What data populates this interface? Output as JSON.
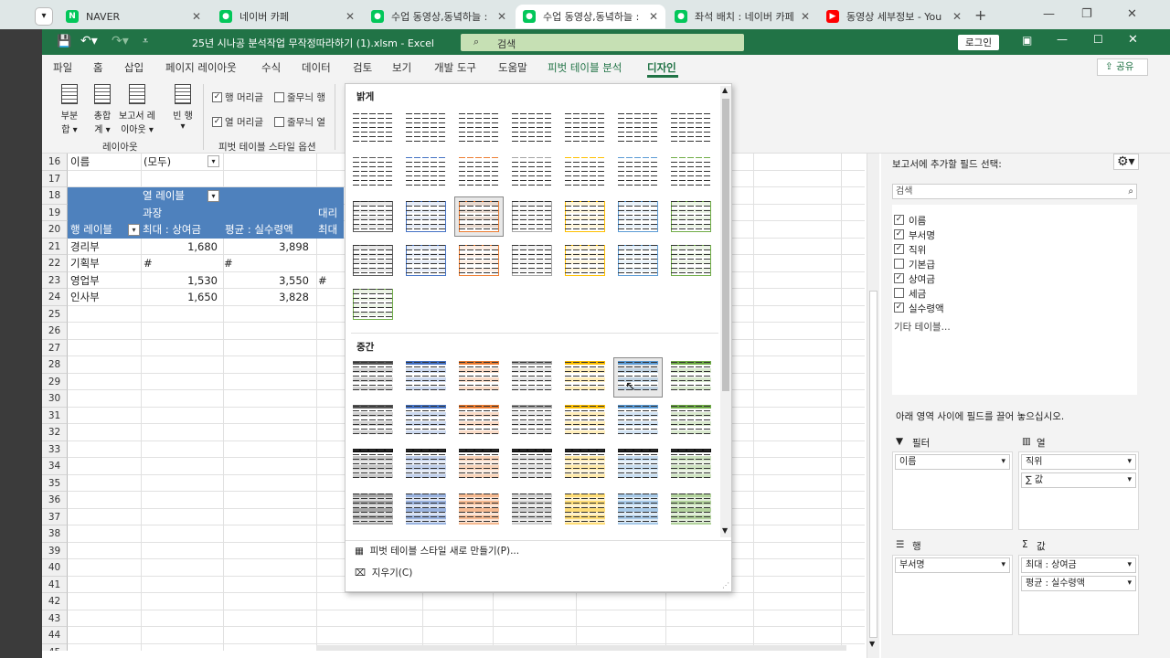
{
  "browser": {
    "tabs": [
      {
        "label": "NAVER",
        "active": false,
        "icon": "naver-icon",
        "color": "#03c75a"
      },
      {
        "label": "네이버 카페",
        "active": false,
        "icon": "cafe-icon",
        "color": "#03c75a"
      },
      {
        "label": "수업 동영상,동녘하늘 :",
        "active": false,
        "icon": "cafe-icon",
        "color": "#03c75a"
      },
      {
        "label": "수업 동영상,동녘하늘 :",
        "active": true,
        "icon": "cafe-icon",
        "color": "#03c75a"
      },
      {
        "label": "좌석 배치 : 네이버 카페",
        "active": false,
        "icon": "cafe-icon",
        "color": "#03c75a"
      },
      {
        "label": "동영상 세부정보 - You",
        "active": false,
        "icon": "youtube-icon",
        "color": "#ff0000"
      }
    ],
    "new_tab": "+"
  },
  "excel": {
    "filename": "25년 시나공 분석작업 무작정따라하기 (1).xlsm",
    "app": "Excel",
    "search_placeholder": "검색",
    "login": "로그인",
    "share": "공유",
    "menu": [
      "파일",
      "홈",
      "삽입",
      "페이지 레이아웃",
      "수식",
      "데이터",
      "검토",
      "보기",
      "개발 도구",
      "도움말",
      "피벗 테이블 분석",
      "디자인"
    ],
    "active_menu": "디자인",
    "ribbon": {
      "layout_buttons": [
        {
          "line1": "부분",
          "line2": "합 ▾"
        },
        {
          "line1": "총합",
          "line2": "계 ▾"
        },
        {
          "line1": "보고서 레",
          "line2": "이아웃 ▾"
        },
        {
          "line1": "빈 행",
          "line2": "▾"
        }
      ],
      "layout_group": "레이아웃",
      "options": [
        {
          "label": "행 머리글",
          "checked": true
        },
        {
          "label": "줄무늬 행",
          "checked": false
        },
        {
          "label": "열 머리글",
          "checked": true
        },
        {
          "label": "줄무늬 열",
          "checked": false
        }
      ],
      "options_group": "피벗 테이블 스타일 옵션"
    }
  },
  "sheet": {
    "rows": [
      "16",
      "17",
      "18",
      "19",
      "20",
      "21",
      "22",
      "23",
      "24",
      "25",
      "26",
      "27",
      "28",
      "29",
      "30",
      "31",
      "32",
      "33",
      "34",
      "35",
      "36",
      "37",
      "38",
      "39",
      "40",
      "41",
      "42",
      "43",
      "44",
      "45"
    ],
    "filter_label": "이름",
    "filter_value": "(모두)",
    "pivot": {
      "col_label": "열 레이블",
      "group1": "과장",
      "group2": "대리",
      "row_label": "행 레이블",
      "h1": "최대 : 상여금",
      "h2": "평균 : 실수령액",
      "h3": "최대",
      "data": [
        {
          "name": "경리부",
          "v1": "1,680",
          "v2": "3,898",
          "v3": ""
        },
        {
          "name": "기획부",
          "v1": "#",
          "v2": "#",
          "v3": ""
        },
        {
          "name": "영업부",
          "v1": "1,530",
          "v2": "3,550",
          "v3": "#"
        },
        {
          "name": "인사부",
          "v1": "1,650",
          "v2": "3,828",
          "v3": ""
        }
      ]
    }
  },
  "gallery": {
    "section_light": "밝게",
    "section_medium": "중간",
    "new_style": "피벗 테이블 스타일 새로 만들기(P)...",
    "clear": "지우기(C)",
    "colors": [
      "#595959",
      "#4472c4",
      "#ed7d31",
      "#a5a5a5",
      "#ffc000",
      "#5b9bd5",
      "#70ad47"
    ]
  },
  "pane": {
    "choose_fields": "보고서에 추가할 필드 선택:",
    "search_placeholder": "검색",
    "fields": [
      {
        "label": "이름",
        "checked": true
      },
      {
        "label": "부서명",
        "checked": true
      },
      {
        "label": "직위",
        "checked": true
      },
      {
        "label": "기본급",
        "checked": false
      },
      {
        "label": "상여금",
        "checked": true
      },
      {
        "label": "세금",
        "checked": false
      },
      {
        "label": "실수령액",
        "checked": true
      }
    ],
    "more_tables": "기타 테이블...",
    "drag_hint": "아래 영역 사이에 필드를 끌어 놓으십시오.",
    "filters": "필터",
    "columns": "열",
    "rows": "행",
    "values": "값",
    "filter_items": [
      "이름"
    ],
    "column_items": [
      "직위",
      "∑ 값"
    ],
    "row_items": [
      "부서명"
    ],
    "value_items": [
      "최대 : 상여금",
      "평균 : 실수령액"
    ]
  }
}
